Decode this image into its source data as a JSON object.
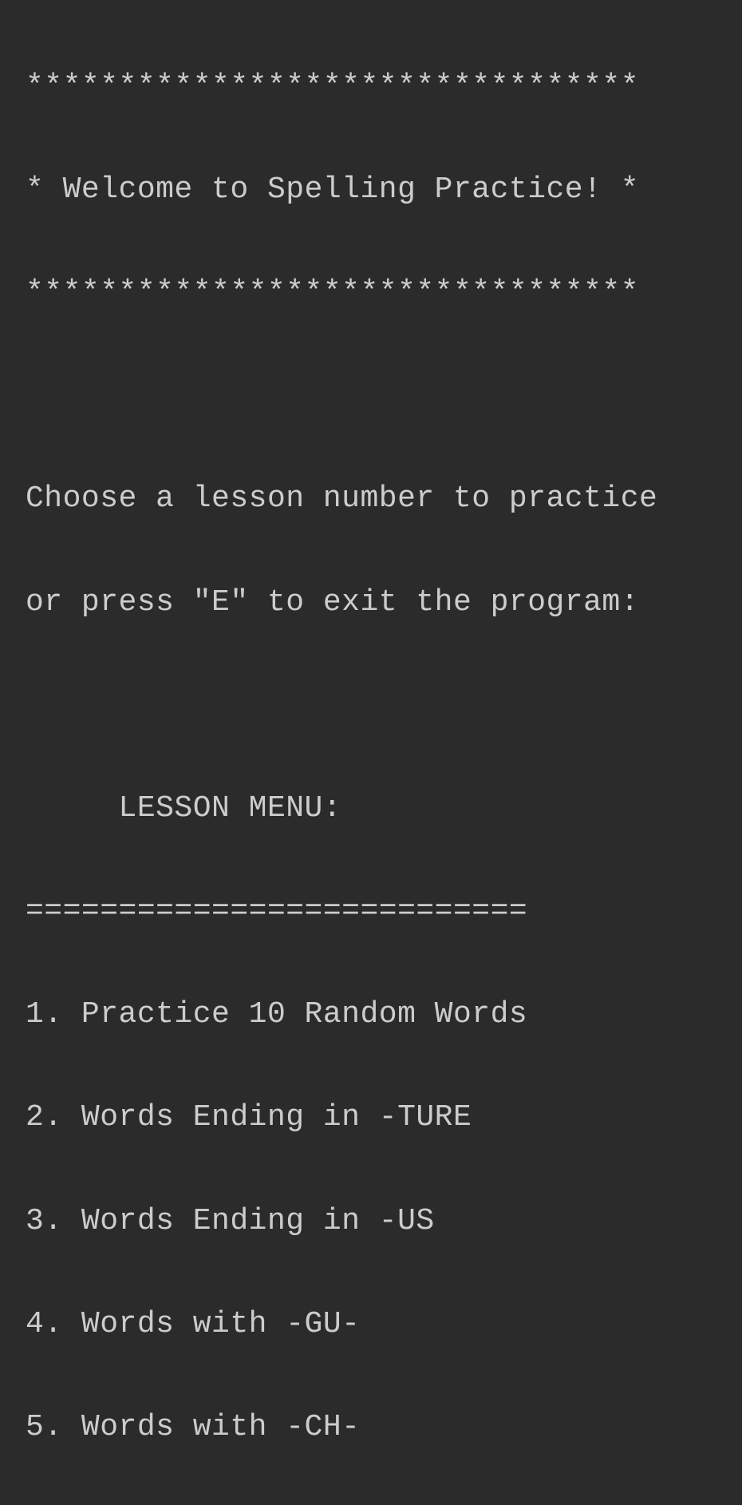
{
  "banner": {
    "border_top": "*********************************",
    "title": "* Welcome to Spelling Practice! *",
    "border_bottom": "*********************************"
  },
  "prompt": {
    "line1": "Choose a lesson number to practice",
    "line2": "or press \"E\" to exit the program:"
  },
  "menu": {
    "header": "     LESSON MENU:",
    "divider": "===========================",
    "items": [
      "1. Practice 10 Random Words",
      "2. Words Ending in -TURE",
      "3. Words Ending in -US",
      "4. Words with -GU-",
      "5. Words with -CH-"
    ]
  }
}
